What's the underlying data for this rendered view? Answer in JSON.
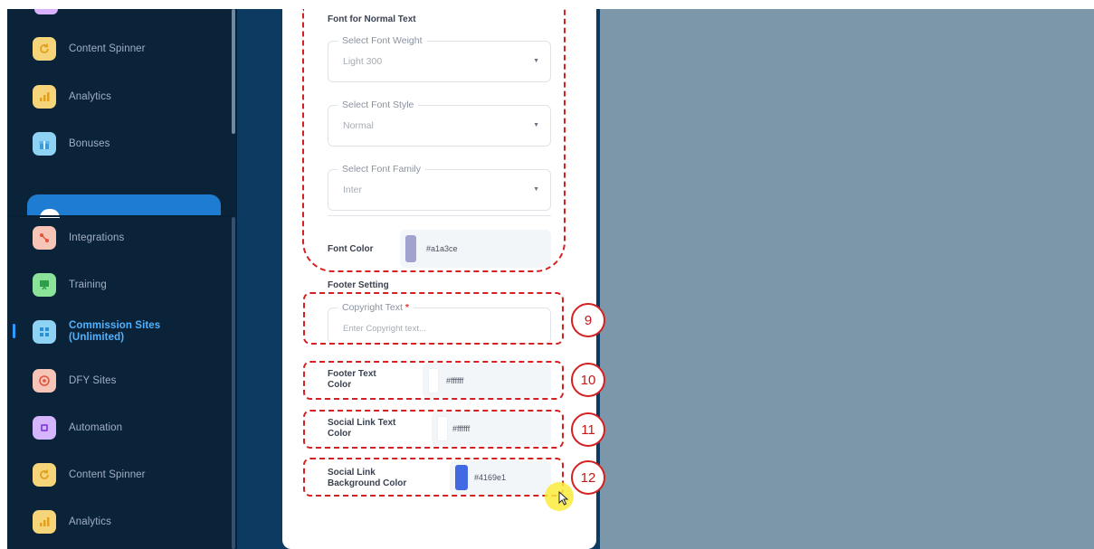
{
  "sidebar": {
    "items": [
      {
        "label": "Content Spinner",
        "icon": "refresh-icon",
        "color": "#f6d57a"
      },
      {
        "label": "Analytics",
        "icon": "bar-chart-icon",
        "color": "#f6d57a"
      },
      {
        "label": "Bonuses",
        "icon": "gift-icon",
        "color": "#8fd3f4"
      },
      {
        "label": "Integrations",
        "icon": "integrations-icon",
        "color": "#f7c5b8"
      },
      {
        "label": "Training",
        "icon": "training-icon",
        "color": "#8be39a"
      },
      {
        "label": "Commission Sites (Unlimited)",
        "label_line1": "Commission Sites",
        "label_line2": "(Unlimited)",
        "icon": "sites-icon",
        "color": "#8fd3f4",
        "active": true
      },
      {
        "label": "DFY Sites",
        "icon": "target-icon",
        "color": "#f7c5b8"
      },
      {
        "label": "Automation",
        "icon": "automation-icon",
        "color": "#d6b5ff"
      },
      {
        "label": "Content Spinner",
        "icon": "refresh-icon",
        "color": "#f6d57a"
      },
      {
        "label": "Analytics",
        "icon": "bar-chart-icon",
        "color": "#f6d57a"
      }
    ]
  },
  "form": {
    "normal_text_title": "Font for Normal Text",
    "font_weight": {
      "legend": "Select Font Weight",
      "value": "Light 300"
    },
    "font_style": {
      "legend": "Select Font Style",
      "value": "Normal"
    },
    "font_family": {
      "legend": "Select Font Family",
      "value": "Inter"
    },
    "font_color": {
      "label": "Font Color",
      "hex": "#a1a3ce",
      "swatch": "#a1a3ce"
    },
    "footer_title": "Footer Setting",
    "copyright": {
      "legend": "Copyright Text",
      "required_mark": "*",
      "placeholder": "Enter Copyright text..."
    },
    "footer_text_color": {
      "label_line1": "Footer Text",
      "label_line2": "Color",
      "hex": "#ffffff"
    },
    "social_link_text_color": {
      "label_line1": "Social Link Text",
      "label_line2": "Color",
      "hex": "#ffffff"
    },
    "social_link_bg_color": {
      "label_line1": "Social Link",
      "label_line2": "Background Color",
      "hex": "#4169e1",
      "swatch": "#4169e1"
    }
  },
  "annotations": {
    "n9": "9",
    "n10": "10",
    "n11": "11",
    "n12": "12"
  },
  "colors": {
    "annotation_red": "#d42020",
    "sidebar_bg": "#0b2339",
    "active_blue": "#4fb3ff"
  }
}
